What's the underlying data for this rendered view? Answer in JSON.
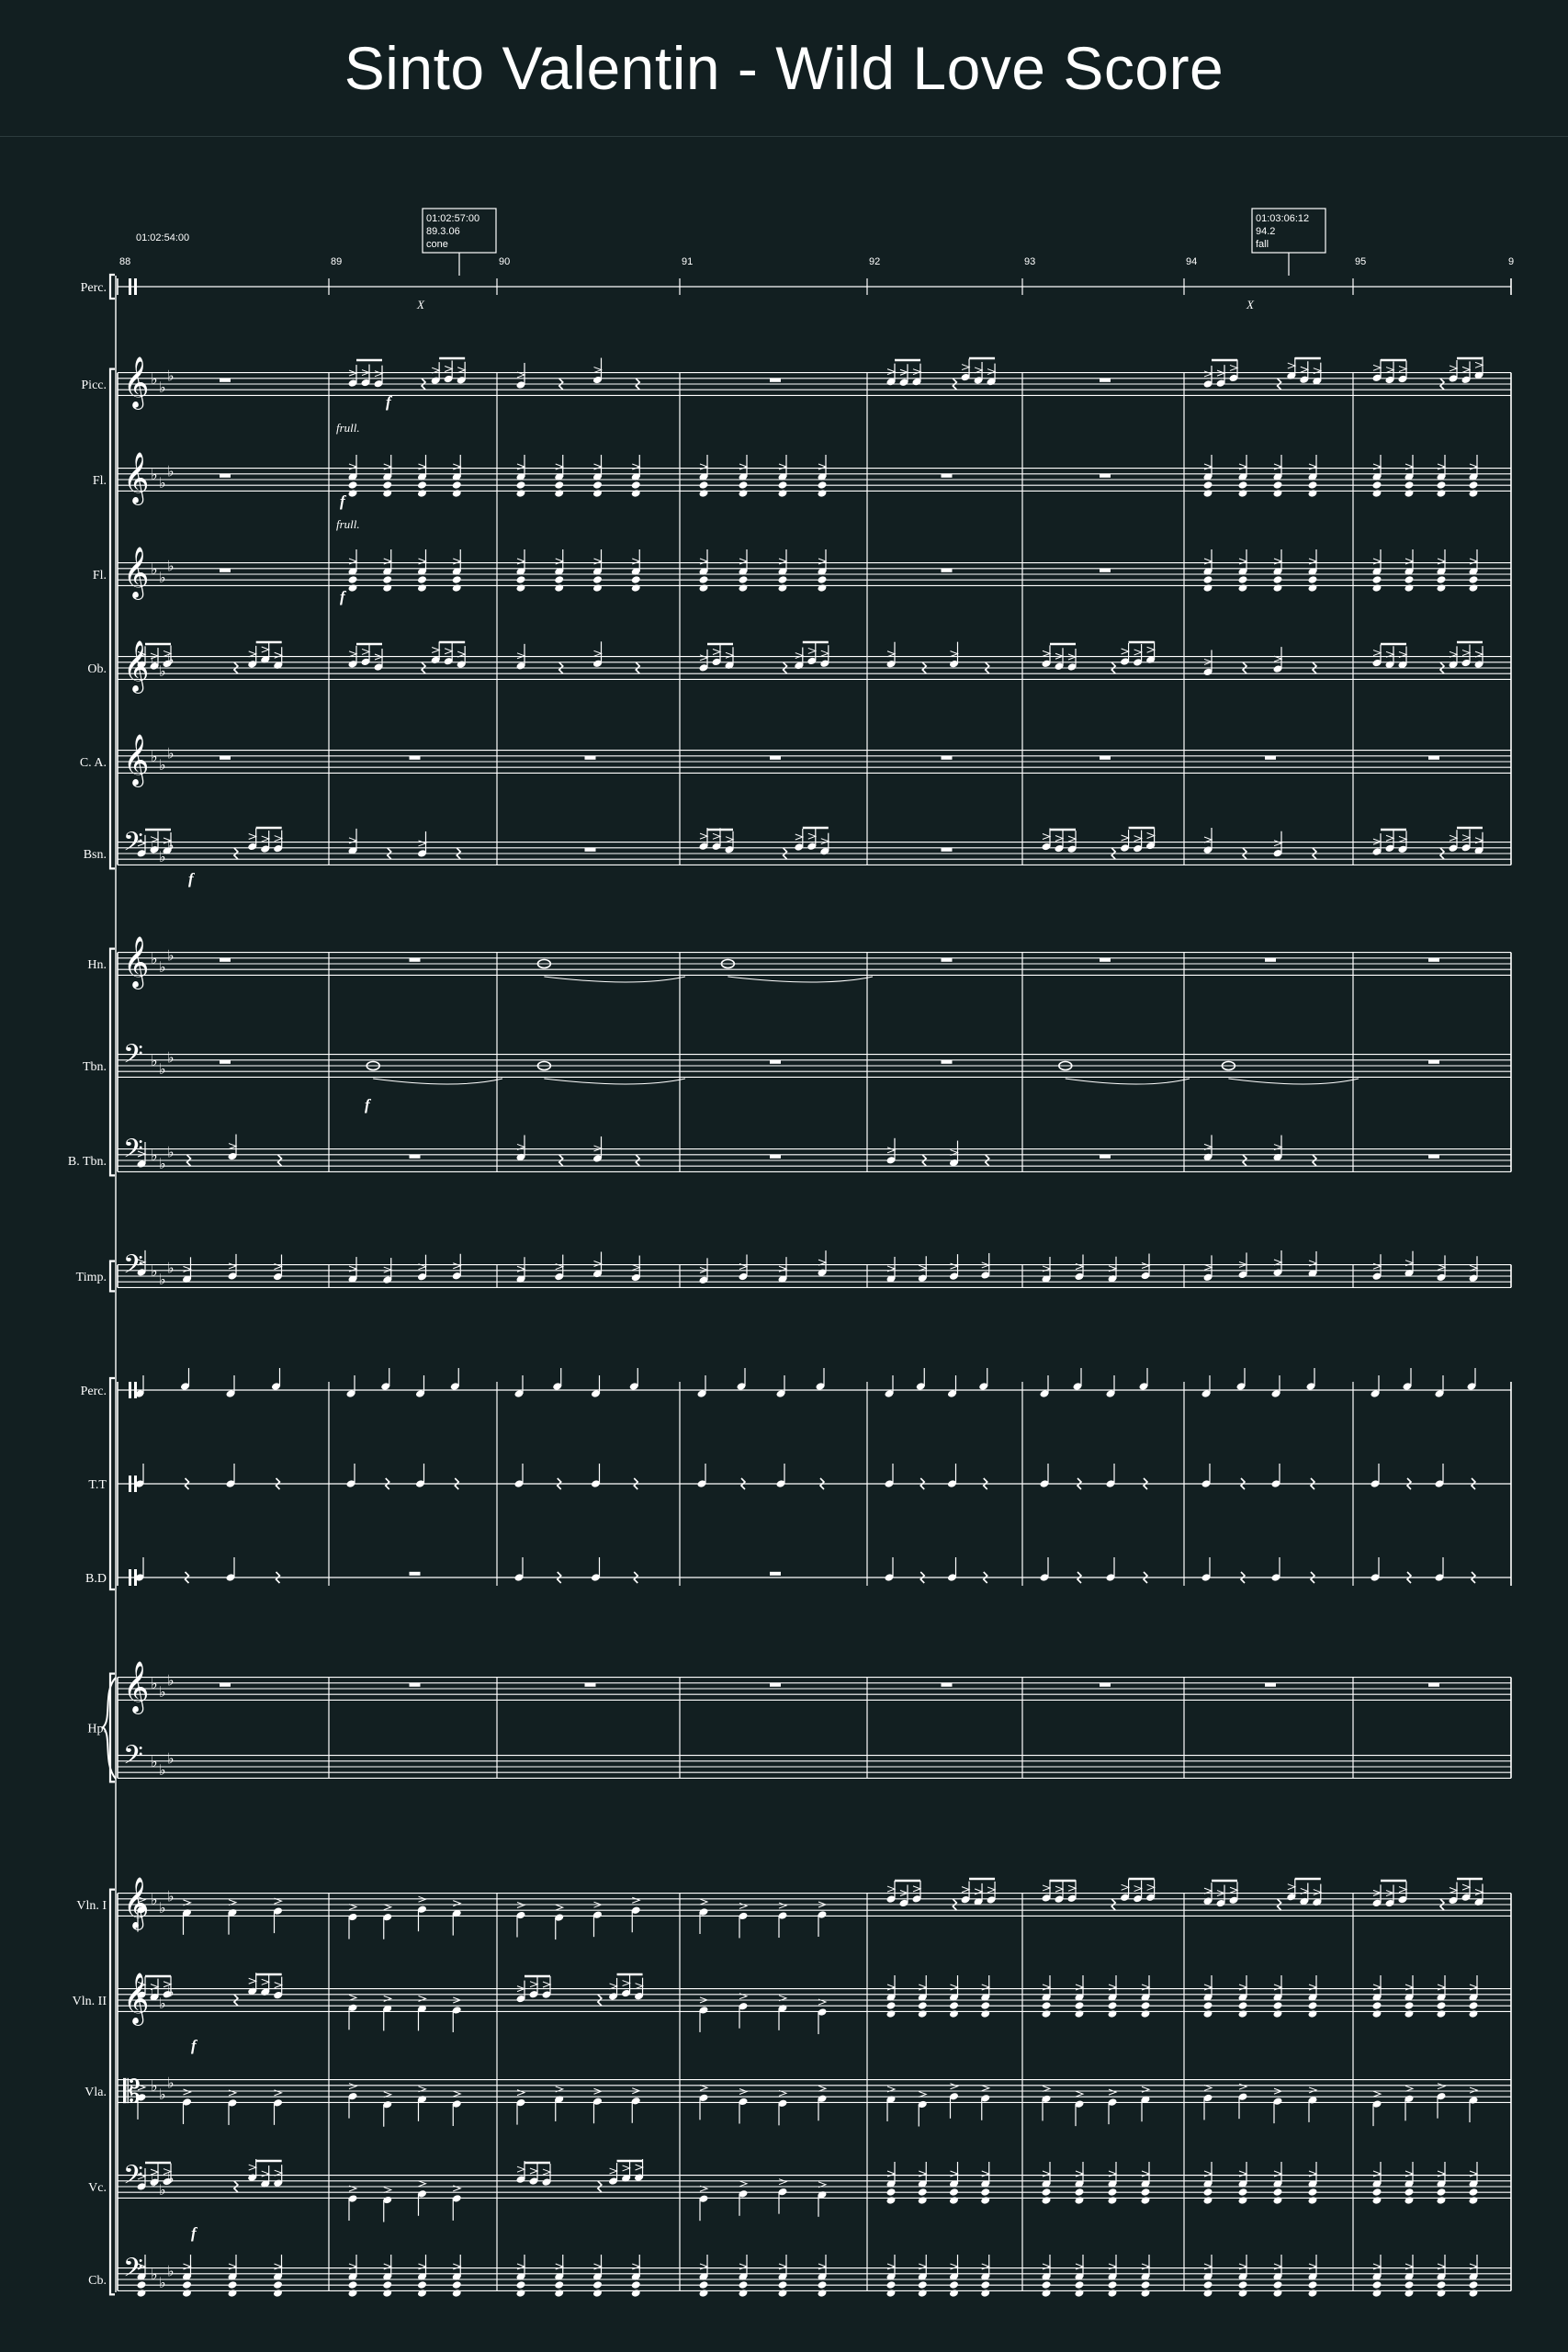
{
  "title": "Sinto Valentin - Wild Love Score",
  "timecodes": {
    "start": "01:02:54:00",
    "marker1": [
      "01:02:57:00",
      "89.3.06",
      "cone"
    ],
    "marker2": [
      "01:03:06:12",
      "94.2",
      "fall"
    ]
  },
  "measure_numbers": [
    "88",
    "89",
    "90",
    "91",
    "92",
    "93",
    "94",
    "95",
    "9"
  ],
  "hit_marks": [
    "X",
    "X"
  ],
  "markings": {
    "frull_1": "frull.",
    "frull_2": "frull."
  },
  "dynamics": [
    "f",
    "f",
    "f",
    "f",
    "f",
    "f",
    "f"
  ],
  "instruments": [
    {
      "label": "Perc.",
      "kind": "top"
    },
    {
      "label": "Picc.",
      "kind": "treble"
    },
    {
      "label": "Fl.",
      "kind": "treble"
    },
    {
      "label": "Fl.",
      "kind": "treble"
    },
    {
      "label": "Ob.",
      "kind": "treble"
    },
    {
      "label": "C. A.",
      "kind": "treble"
    },
    {
      "label": "Bsn.",
      "kind": "bass"
    },
    {
      "label": "Hn.",
      "kind": "treble"
    },
    {
      "label": "Tbn.",
      "kind": "bass"
    },
    {
      "label": "B. Tbn.",
      "kind": "bass"
    },
    {
      "label": "Timp.",
      "kind": "bass"
    },
    {
      "label": "Perc.",
      "kind": "perc"
    },
    {
      "label": "T.T",
      "kind": "perc"
    },
    {
      "label": "B.D",
      "kind": "perc"
    },
    {
      "label": "Hp.",
      "kind": "grand"
    },
    {
      "label": "Vln. I",
      "kind": "treble"
    },
    {
      "label": "Vln. II",
      "kind": "treble"
    },
    {
      "label": "Vla.",
      "kind": "alto"
    },
    {
      "label": "Vc.",
      "kind": "bass"
    },
    {
      "label": "Cb.",
      "kind": "bass"
    }
  ]
}
